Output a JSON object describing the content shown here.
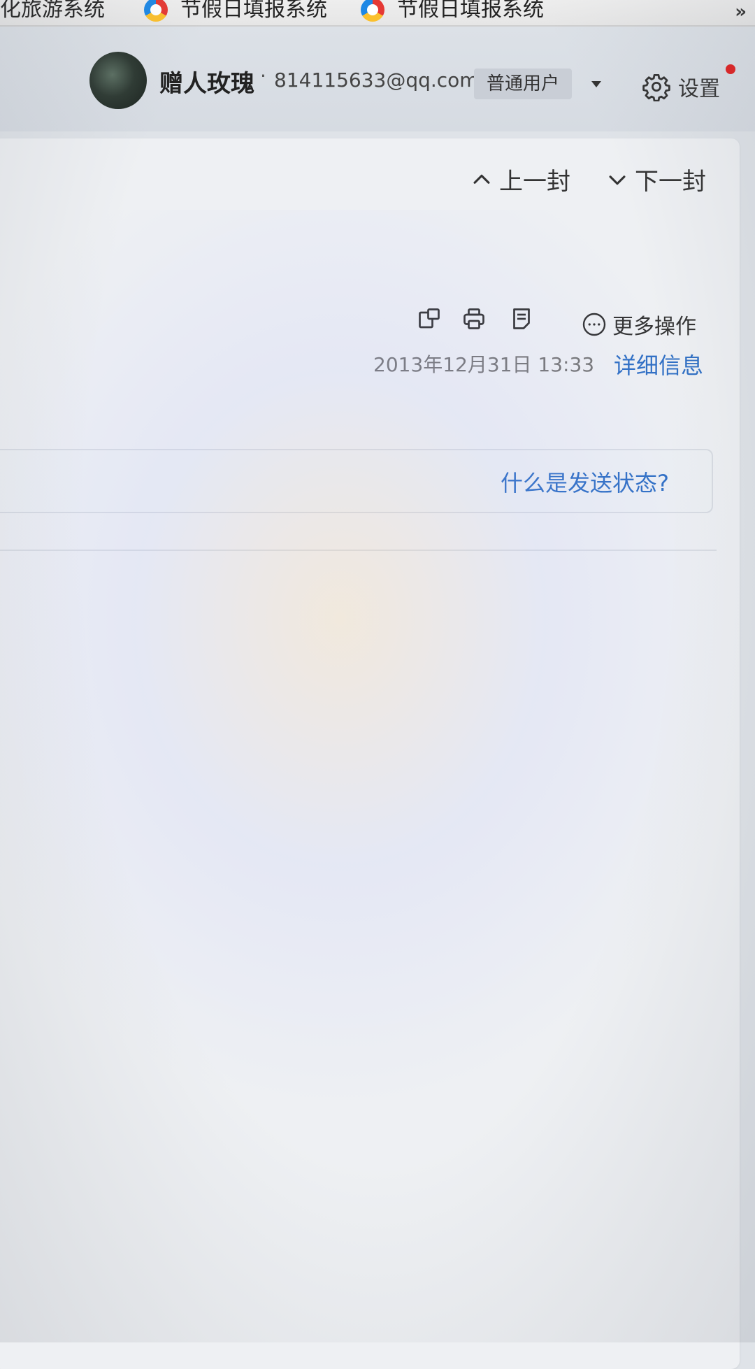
{
  "bookmarks": {
    "items": [
      {
        "label": "文化旅游系统",
        "icon": "browser-favicon"
      },
      {
        "label": "节假日填报系统",
        "icon": "browser-favicon"
      },
      {
        "label": "节假日填报系统",
        "icon": "browser-favicon"
      }
    ],
    "more_label": "»"
  },
  "header": {
    "user_name": "赠人玫瑰",
    "separator": "·",
    "user_email": "814115633@qq.com",
    "user_type": "普通用户",
    "settings_label": "设置",
    "settings_icon": "gear-icon",
    "notification_color": "#e02020"
  },
  "mail": {
    "prev_label": "上一封",
    "next_label": "下一封",
    "toolbar_icons": [
      "new-window-icon",
      "print-icon",
      "note-icon",
      "more-icon"
    ],
    "more_actions_label": "更多操作",
    "date": "2013年12月31日 13:33",
    "detail_link": "详细信息",
    "status_help_link": "什么是发送状态?"
  },
  "colors": {
    "link": "#2f6fc4",
    "header_bg": "#d6dbe2",
    "content_bg": "#eef0f3"
  }
}
